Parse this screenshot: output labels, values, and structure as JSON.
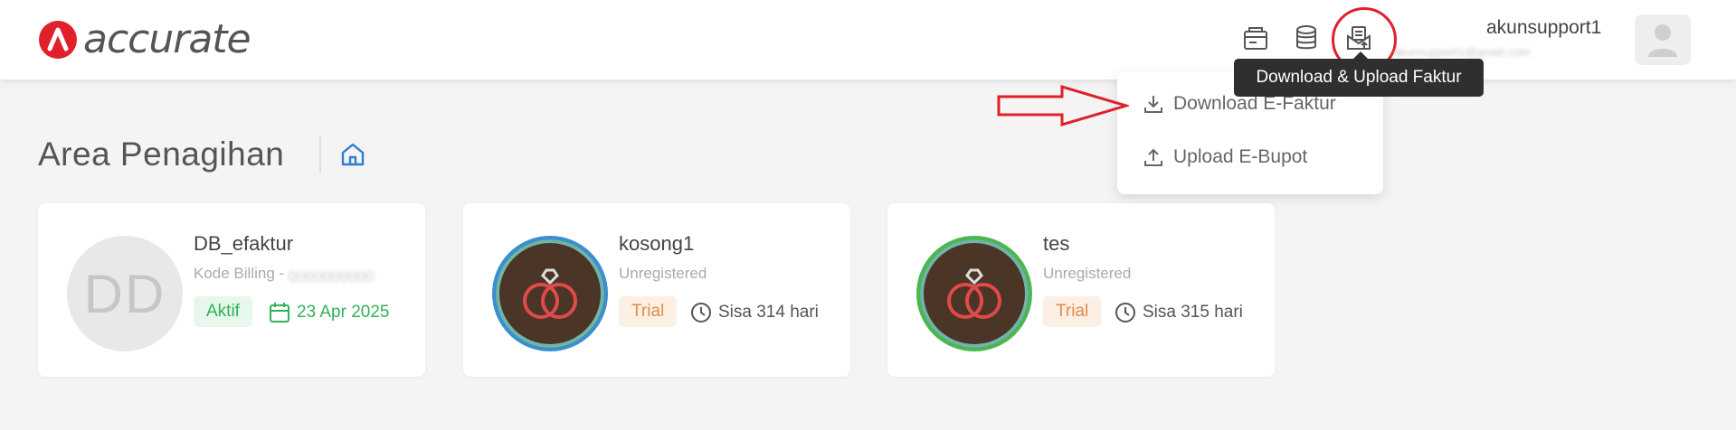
{
  "brand": {
    "name": "accurate",
    "logo_color": "#e0202a"
  },
  "header": {
    "icons": [
      "billing-card-icon",
      "database-icon",
      "download-upload-faktur-icon"
    ],
    "tooltip": "Download & Upload Faktur",
    "username": "akunsupport1",
    "user_sub": "akunsupport1@gmail.com"
  },
  "dropdown": {
    "items": [
      {
        "label": "Download E-Faktur",
        "icon": "download-icon"
      },
      {
        "label": "Upload E-Bupot",
        "icon": "upload-icon"
      }
    ]
  },
  "page": {
    "title": "Area Penagihan"
  },
  "cards": [
    {
      "name": "DB_efaktur",
      "avatar_text": "DD",
      "subtitle_prefix": "Kode Billing - ",
      "subtitle_hidden": "0000000000",
      "badge": "Aktif",
      "meta": "23 Apr 2025"
    },
    {
      "name": "kosong1",
      "subtitle": "Unregistered",
      "badge": "Trial",
      "meta": "Sisa 314 hari",
      "ring_color": "#3a8fd0"
    },
    {
      "name": "tes",
      "subtitle": "Unregistered",
      "badge": "Trial",
      "meta": "Sisa 315 hari",
      "ring_color": "#4ab84e"
    }
  ],
  "colors": {
    "accent_red": "#e0202a",
    "success_green": "#2fb359",
    "trial_orange": "#e38b43"
  }
}
